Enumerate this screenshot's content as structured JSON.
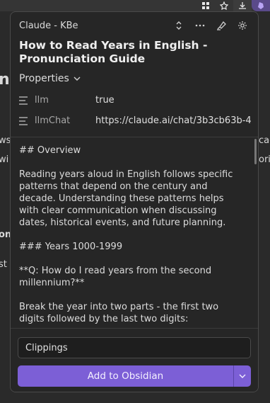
{
  "background": {
    "fragments": [
      "ng",
      "ws s",
      "wi",
      "cac",
      "ori",
      "on",
      "st"
    ]
  },
  "popup": {
    "vault_name": "Claude - KBe",
    "title": "How to Read Years in English - Pronunciation Guide",
    "properties_label": "Properties",
    "properties": [
      {
        "key": "llm",
        "value": "true"
      },
      {
        "key": "llmChat",
        "value": "https://claude.ai/chat/3b3cb63b-4"
      }
    ],
    "content": [
      "## Overview",
      "Reading years aloud in English follows specific patterns that depend on the century and decade. Understanding these patterns helps with clear communication when discussing dates, historical events, and future planning.",
      "### Years 1000-1999",
      "**Q: How do I read years from the second millennium?**",
      "Break the year into two parts - the first two digits followed by the last two digits:"
    ],
    "clippings_value": "Clippings",
    "add_button_label": "Add to Obsidian"
  },
  "icons": {
    "header": [
      "chevron-updown-icon",
      "more-icon",
      "highlighter-icon",
      "settings-icon"
    ],
    "accent_color": "#7c5fd6"
  }
}
